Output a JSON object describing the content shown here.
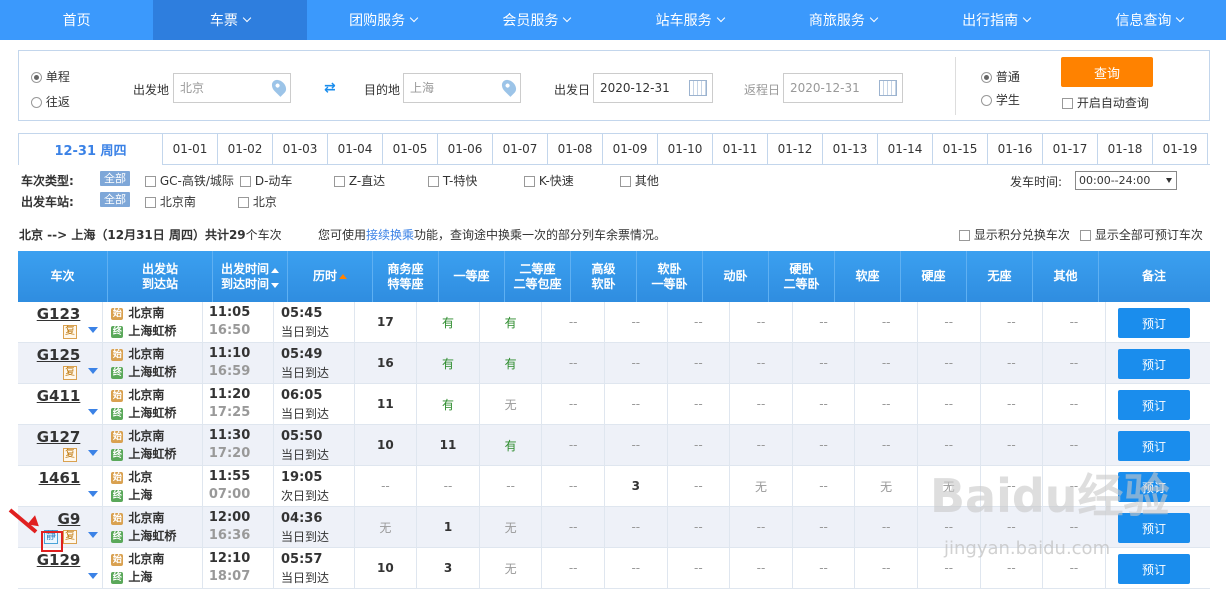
{
  "nav": {
    "items": [
      {
        "label": "首页",
        "has_dropdown": false,
        "active": false
      },
      {
        "label": "车票",
        "has_dropdown": true,
        "active": true
      },
      {
        "label": "团购服务",
        "has_dropdown": true,
        "active": false
      },
      {
        "label": "会员服务",
        "has_dropdown": true,
        "active": false
      },
      {
        "label": "站车服务",
        "has_dropdown": true,
        "active": false
      },
      {
        "label": "商旅服务",
        "has_dropdown": true,
        "active": false
      },
      {
        "label": "出行指南",
        "has_dropdown": true,
        "active": false
      },
      {
        "label": "信息查询",
        "has_dropdown": true,
        "active": false
      }
    ]
  },
  "search": {
    "trip_one_way": "单程",
    "trip_round": "往返",
    "from_label": "出发地",
    "from_value": "北京",
    "to_label": "目的地",
    "to_value": "上海",
    "depart_label": "出发日",
    "depart_value": "2020-12-31",
    "return_label": "返程日",
    "return_value": "2020-12-31",
    "type_normal": "普通",
    "type_student": "学生",
    "query_button": "查询",
    "auto_query": "开启自动查询"
  },
  "dates": {
    "current": "12-31 周四",
    "list": [
      "01-01",
      "01-02",
      "01-03",
      "01-04",
      "01-05",
      "01-06",
      "01-07",
      "01-08",
      "01-09",
      "01-10",
      "01-11",
      "01-12",
      "01-13",
      "01-14",
      "01-15",
      "01-16",
      "01-17",
      "01-18",
      "01-19"
    ]
  },
  "filters": {
    "train_type_label": "车次类型:",
    "all_label": "全部",
    "train_types": [
      "GC-高铁/城际",
      "D-动车",
      "Z-直达",
      "T-特快",
      "K-快速",
      "其他"
    ],
    "station_label": "出发车站:",
    "stations": [
      "北京南",
      "北京"
    ],
    "time_label": "发车时间:",
    "time_value": "00:00--24:00"
  },
  "summary": {
    "route": "北京 --> 上海（12月31日 周四）共计",
    "count": "29",
    "count_suffix": "个车次",
    "tip_prefix": "您可使用",
    "tip_link": "接续换乘",
    "tip_suffix": "功能，查询途中换乘一次的部分列车余票情况。",
    "show_points": "显示积分兑换车次",
    "show_all": "显示全部可预订车次"
  },
  "table": {
    "headers": {
      "train": "车次",
      "stations_1": "出发站",
      "stations_2": "到达站",
      "time_1": "出发时间",
      "time_2": "到达时间",
      "duration": "历时",
      "biz_1": "商务座",
      "biz_2": "特等座",
      "first": "一等座",
      "second_1": "二等座",
      "second_2": "二等包座",
      "adv_1": "高级",
      "adv_2": "软卧",
      "soft_1": "软卧",
      "soft_2": "一等卧",
      "dongwo": "动卧",
      "hard_1": "硬卧",
      "hard_2": "二等卧",
      "softseat": "软座",
      "hardseat": "硬座",
      "noseat": "无座",
      "other": "其他",
      "remark": "备注"
    },
    "rows": [
      {
        "train": "G123",
        "fu": "复",
        "jing": "",
        "from": "北京南",
        "to": "上海虹桥",
        "dep": "11:05",
        "arr": "16:50",
        "dur": "05:45",
        "arrive_day": "当日到达",
        "seats": [
          "17",
          "有",
          "有",
          "--",
          "--",
          "--",
          "--",
          "--",
          "--",
          "--",
          "--",
          "--"
        ],
        "book": "预订"
      },
      {
        "train": "G125",
        "fu": "复",
        "jing": "",
        "from": "北京南",
        "to": "上海虹桥",
        "dep": "11:10",
        "arr": "16:59",
        "dur": "05:49",
        "arrive_day": "当日到达",
        "seats": [
          "16",
          "有",
          "有",
          "--",
          "--",
          "--",
          "--",
          "--",
          "--",
          "--",
          "--",
          "--"
        ],
        "book": "预订"
      },
      {
        "train": "G411",
        "fu": "",
        "jing": "",
        "from": "北京南",
        "to": "上海虹桥",
        "dep": "11:20",
        "arr": "17:25",
        "dur": "06:05",
        "arrive_day": "当日到达",
        "seats": [
          "11",
          "有",
          "无",
          "--",
          "--",
          "--",
          "--",
          "--",
          "--",
          "--",
          "--",
          "--"
        ],
        "book": "预订"
      },
      {
        "train": "G127",
        "fu": "复",
        "jing": "",
        "from": "北京南",
        "to": "上海虹桥",
        "dep": "11:30",
        "arr": "17:20",
        "dur": "05:50",
        "arrive_day": "当日到达",
        "seats": [
          "10",
          "11",
          "有",
          "--",
          "--",
          "--",
          "--",
          "--",
          "--",
          "--",
          "--",
          "--"
        ],
        "book": "预订"
      },
      {
        "train": "1461",
        "fu": "",
        "jing": "",
        "from": "北京",
        "to": "上海",
        "dep": "11:55",
        "arr": "07:00",
        "dur": "19:05",
        "arrive_day": "次日到达",
        "seats": [
          "--",
          "--",
          "--",
          "--",
          "3",
          "--",
          "无",
          "--",
          "无",
          "无",
          "--",
          "--"
        ],
        "book": "预订"
      },
      {
        "train": "G9",
        "fu": "复",
        "jing": "静",
        "from": "北京南",
        "to": "上海虹桥",
        "dep": "12:00",
        "arr": "16:36",
        "dur": "04:36",
        "arrive_day": "当日到达",
        "seats": [
          "无",
          "1",
          "无",
          "--",
          "--",
          "--",
          "--",
          "--",
          "--",
          "--",
          "--",
          "--"
        ],
        "book": "预订"
      },
      {
        "train": "G129",
        "fu": "",
        "jing": "",
        "from": "北京南",
        "to": "上海",
        "dep": "12:10",
        "arr": "18:07",
        "dur": "05:57",
        "arrive_day": "当日到达",
        "seats": [
          "10",
          "3",
          "无",
          "--",
          "--",
          "--",
          "--",
          "--",
          "--",
          "--",
          "--",
          "--"
        ],
        "book": "预订"
      }
    ]
  },
  "watermark": {
    "brand": "Baidu经验",
    "url": "jingyan.baidu.com"
  }
}
